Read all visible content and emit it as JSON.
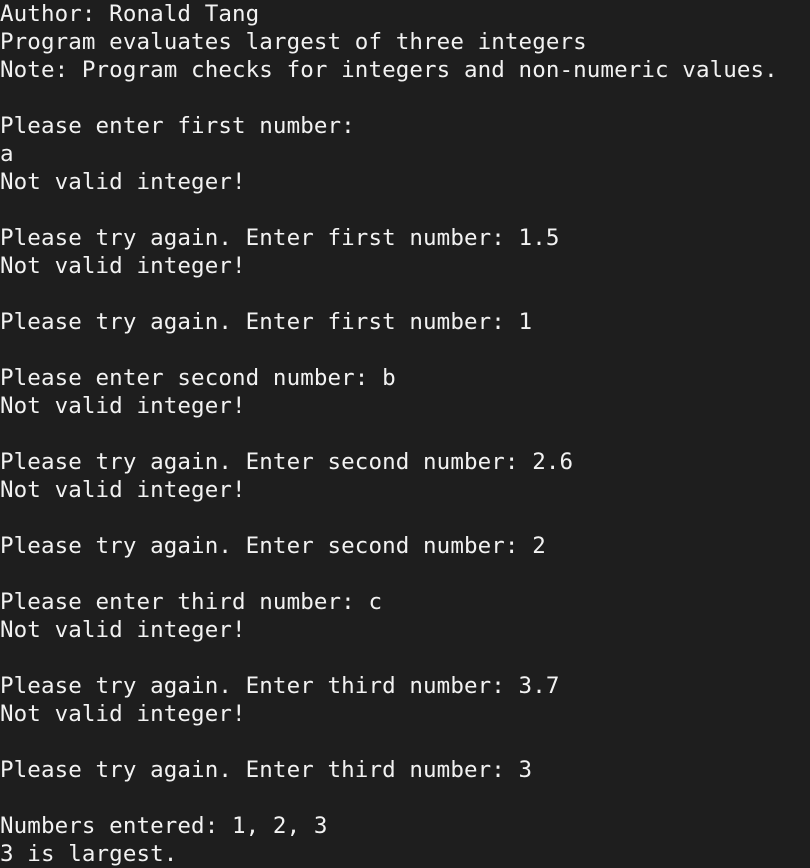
{
  "colors": {
    "background": "#1e1e1e",
    "text": "#f2f2f2"
  },
  "terminal": {
    "lines": [
      "Author: Ronald Tang",
      "Program evaluates largest of three integers",
      "Note: Program checks for integers and non-numeric values.",
      "",
      "Please enter first number:",
      "a",
      "Not valid integer!",
      "",
      "Please try again. Enter first number: 1.5",
      "Not valid integer!",
      "",
      "Please try again. Enter first number: 1",
      "",
      "Please enter second number: b",
      "Not valid integer!",
      "",
      "Please try again. Enter second number: 2.6",
      "Not valid integer!",
      "",
      "Please try again. Enter second number: 2",
      "",
      "Please enter third number: c",
      "Not valid integer!",
      "",
      "Please try again. Enter third number: 3.7",
      "Not valid integer!",
      "",
      "Please try again. Enter third number: 3",
      "",
      "Numbers entered: 1, 2, 3",
      "3 is largest."
    ]
  }
}
